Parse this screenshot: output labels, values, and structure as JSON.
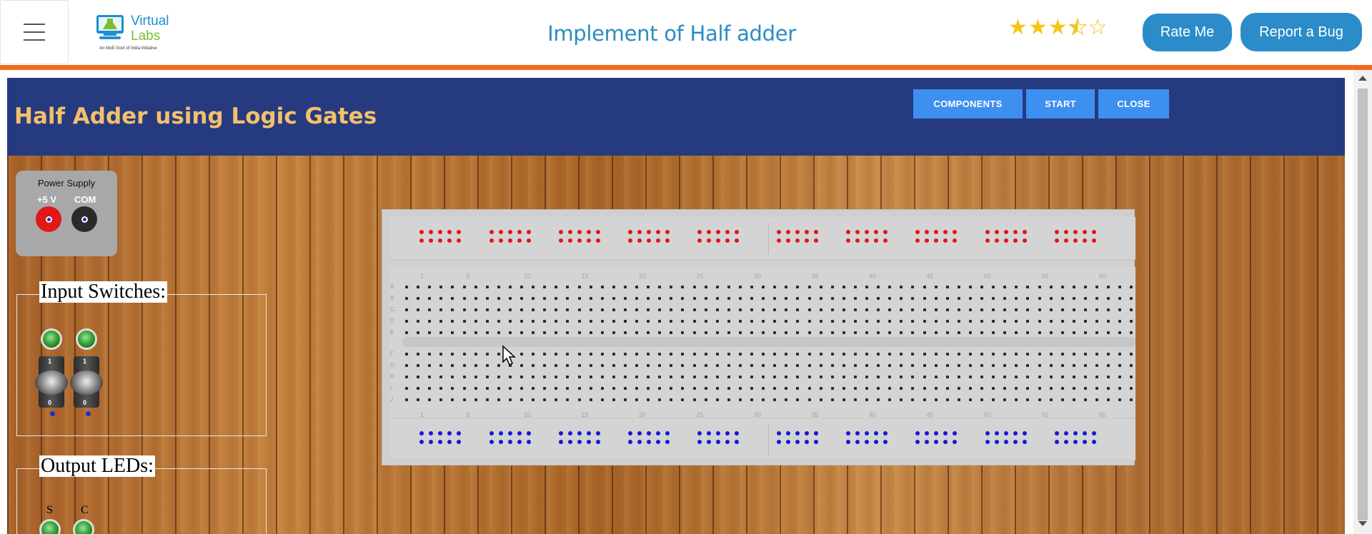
{
  "header": {
    "logo_line1": "Virtual",
    "logo_line2": "Labs",
    "logo_tagline": "An MoE Govt of India Initiative",
    "title": "Implement of Half adder",
    "rating": 3.5,
    "rating_max": 5,
    "rate_button": "Rate Me",
    "bug_button": "Report a Bug"
  },
  "simulator": {
    "title": "Half Adder using Logic Gates",
    "buttons": {
      "components": "COMPONENTS",
      "start": "START",
      "close": "CLOSE"
    },
    "power_supply": {
      "label": "Power Supply",
      "plus": "+5 V",
      "com": "COM"
    },
    "input_switches": {
      "legend": "Input Switches:",
      "count": 2,
      "high_label": "1",
      "low_label": "0"
    },
    "output_leds": {
      "legend": "Output LEDs:",
      "labels": [
        "S",
        "C"
      ]
    },
    "breadboard": {
      "column_numbers": [
        "1",
        "5",
        "10",
        "15",
        "20",
        "25",
        "30",
        "35",
        "40",
        "45",
        "50",
        "55",
        "60"
      ],
      "top_rows": [
        "A",
        "B",
        "C",
        "D",
        "E"
      ],
      "bottom_rows": [
        "F",
        "G",
        "H",
        "I",
        "J"
      ]
    }
  },
  "colors": {
    "accent_orange": "#f26b1d",
    "sim_header": "#263a80",
    "sim_title": "#f4c06b",
    "button_blue": "#3d8ff0",
    "brand_blue": "#2b8cc9"
  }
}
